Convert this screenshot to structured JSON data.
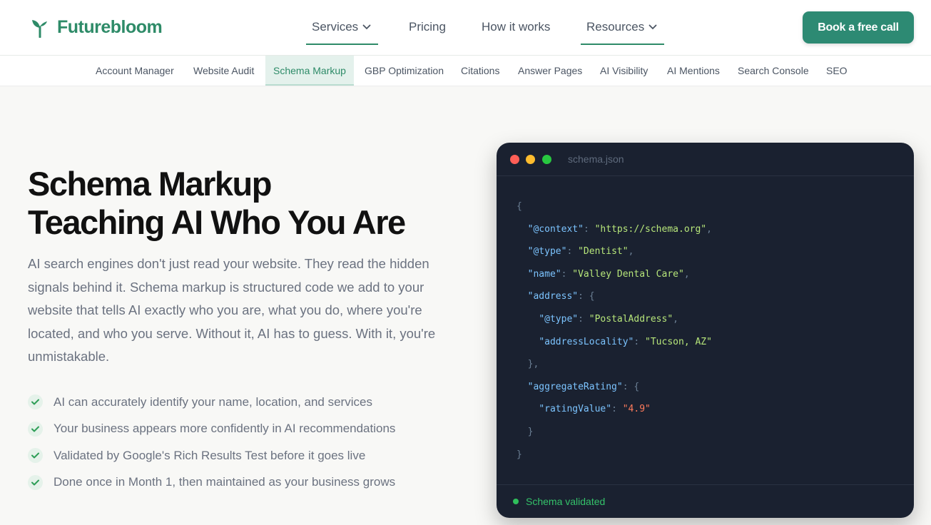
{
  "brand": {
    "name": "Futurebloom",
    "color": "#2e8b68"
  },
  "nav": {
    "items": [
      {
        "label": "Services",
        "dropdown": true,
        "active": true
      },
      {
        "label": "Pricing",
        "dropdown": false,
        "active": false
      },
      {
        "label": "How it works",
        "dropdown": false,
        "active": false
      },
      {
        "label": "Resources",
        "dropdown": true,
        "active": true
      }
    ],
    "cta_label": "Book a free call"
  },
  "subnav": {
    "items": [
      "Account Manager",
      "Website Audit",
      "Schema Markup",
      "GBP Optimization",
      "Citations",
      "Answer Pages",
      "AI Visibility",
      "AI Mentions",
      "Search Console",
      "SEO"
    ],
    "active": "Schema Markup"
  },
  "hero": {
    "title_line1": "Schema Markup",
    "title_line2": "Teaching AI Who You Are",
    "description": "AI search engines don't just read your website. They read the hidden signals behind it. Schema markup is structured code we add to your website that tells AI exactly who you are, what you do, where you're located, and who you serve. Without it, AI has to guess. With it, you're unmistakable.",
    "features": [
      "AI can accurately identify your name, location, and services",
      "Your business appears more confidently in AI recommendations",
      "Validated by Google's Rich Results Test before it goes live",
      "Done once in Month 1, then maintained as your business grows"
    ]
  },
  "code_window": {
    "filename": "schema.json",
    "status": "Schema validated",
    "json": {
      "context_key": "\"@context\"",
      "context_val": "\"https://schema.org\"",
      "type_key": "\"@type\"",
      "type_val": "\"Dentist\"",
      "name_key": "\"name\"",
      "name_val": "\"Valley Dental Care\"",
      "address_key": "\"address\"",
      "addr_type_key": "\"@type\"",
      "addr_type_val": "\"PostalAddress\"",
      "locality_key": "\"addressLocality\"",
      "locality_val": "\"Tucson, AZ\"",
      "rating_key": "\"aggregateRating\"",
      "rating_value_key": "\"ratingValue\"",
      "rating_value_val": "\"4.9\""
    }
  }
}
